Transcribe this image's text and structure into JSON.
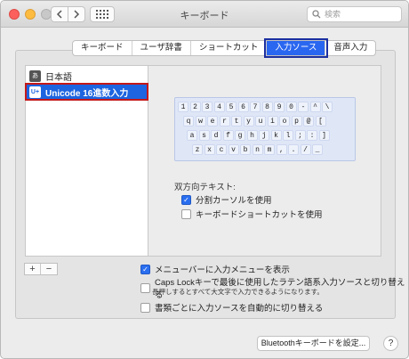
{
  "window": {
    "title": "キーボード"
  },
  "search": {
    "placeholder": "検索"
  },
  "tabs": [
    {
      "label": "キーボード"
    },
    {
      "label": "ユーザ辞書"
    },
    {
      "label": "ショートカット"
    },
    {
      "label": "入力ソース",
      "active": true
    },
    {
      "label": "音声入力"
    }
  ],
  "sources": [
    {
      "badge": "あ",
      "label": "日本語"
    },
    {
      "badge": "U+",
      "label": "Unicode 16進数入力",
      "selected": true
    }
  ],
  "keyboard": {
    "rows": [
      [
        "1",
        "2",
        "3",
        "4",
        "5",
        "6",
        "7",
        "8",
        "9",
        "0",
        "-",
        "^",
        "\\"
      ],
      [
        "q",
        "w",
        "e",
        "r",
        "t",
        "y",
        "u",
        "i",
        "o",
        "p",
        "@",
        "["
      ],
      [
        "a",
        "s",
        "d",
        "f",
        "g",
        "h",
        "j",
        "k",
        "l",
        ";",
        ":",
        "]"
      ],
      [
        "z",
        "x",
        "c",
        "v",
        "b",
        "n",
        "m",
        ",",
        ".",
        "/",
        "_"
      ]
    ]
  },
  "bidi": {
    "title": "双方向テキスト:",
    "split_cursor": {
      "label": "分割カーソルを使用",
      "checked": true
    },
    "kbd_shortcut": {
      "label": "キーボードショートカットを使用",
      "checked": false
    }
  },
  "list_buttons": {
    "add": "+",
    "remove": "−"
  },
  "options": {
    "show_menu": {
      "label": "メニューバーに入力メニューを表示",
      "checked": true
    },
    "caps_lock": {
      "label": "Caps Lockキーで最後に使用したラテン語系入力ソースと切り替える",
      "checked": false
    },
    "caps_note": "長押しするとすべて大文字で入力できるようになります。",
    "auto_switch": {
      "label": "書類ごとに入力ソースを自動的に切り替える",
      "checked": false
    }
  },
  "footer": {
    "bluetooth_button": "Bluetoothキーボードを設定...",
    "help": "?"
  }
}
